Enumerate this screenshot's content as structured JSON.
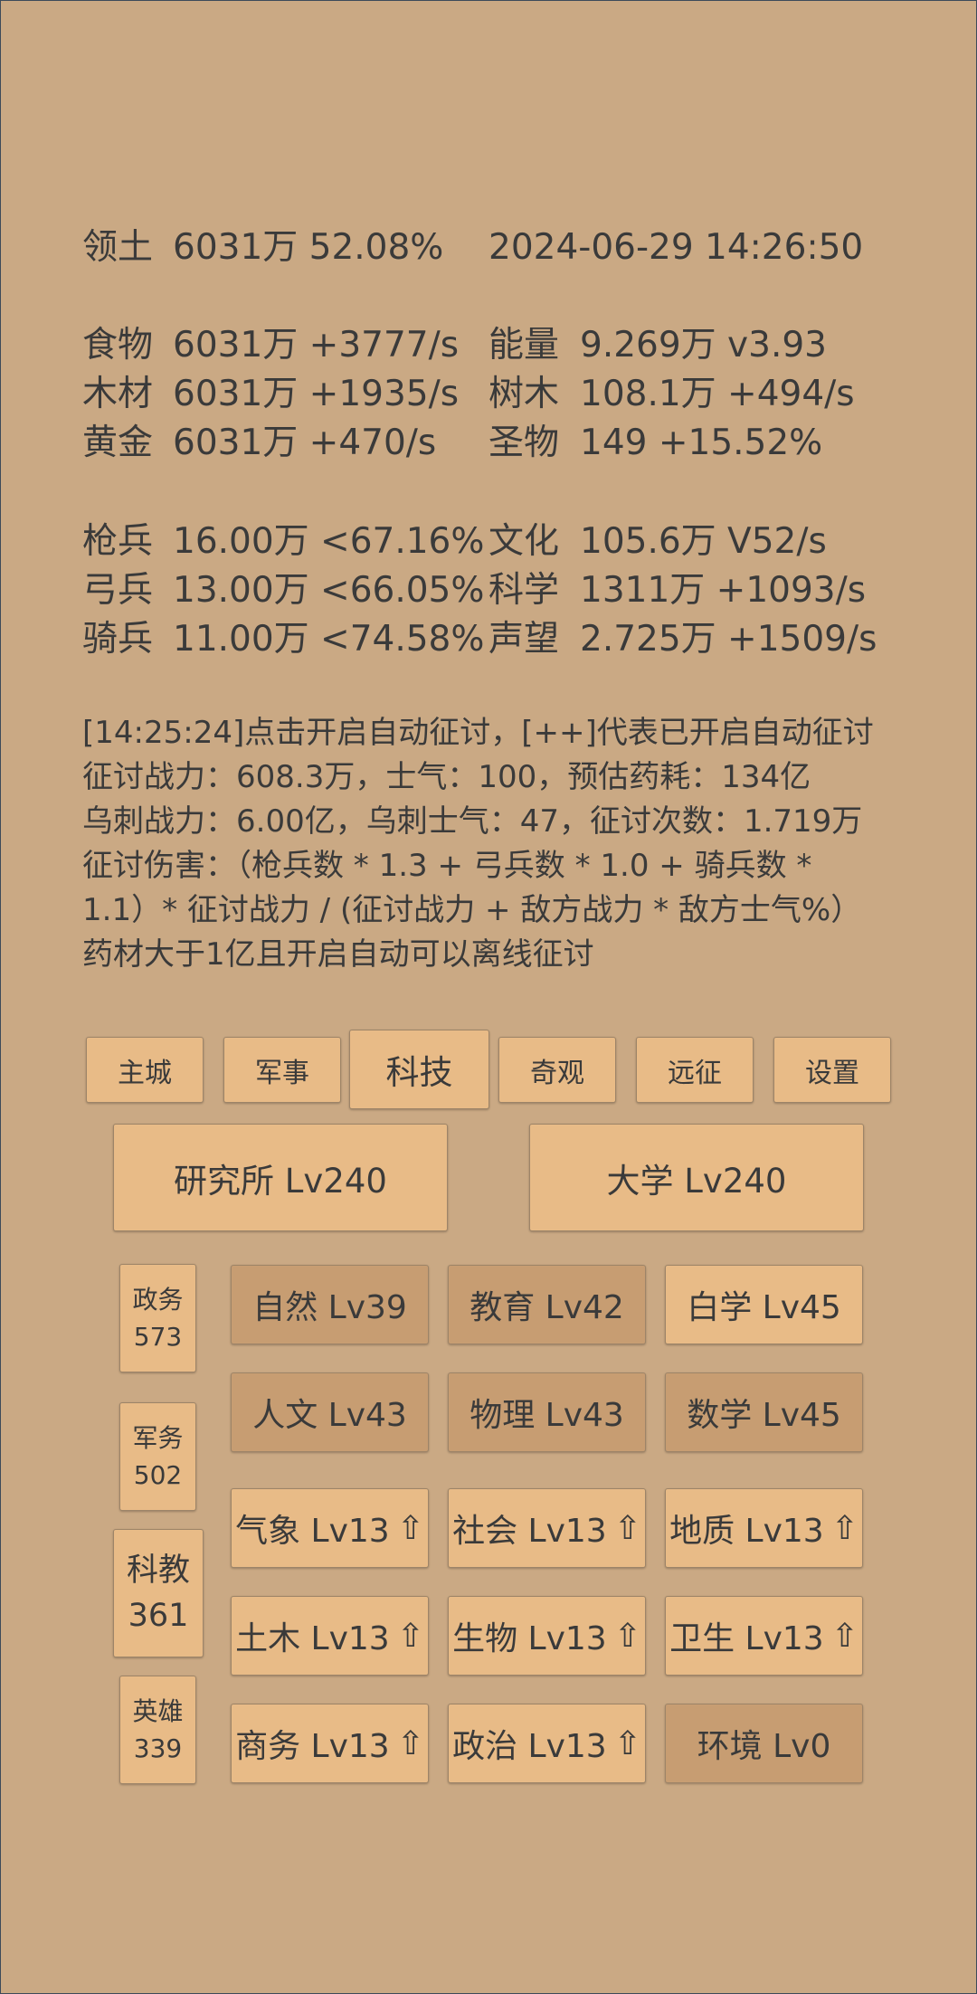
{
  "header": {
    "territory_label": "领土",
    "territory_value": "6031万  52.08%",
    "datetime": "2024-06-29 14:26:50"
  },
  "resources": [
    {
      "left_label": "食物",
      "left_value": "6031万 +3777/s",
      "right_label": "能量",
      "right_value": "9.269万  v3.93"
    },
    {
      "left_label": "木材",
      "left_value": "6031万 +1935/s",
      "right_label": "树木",
      "right_value": "108.1万 +494/s"
    },
    {
      "left_label": "黄金",
      "left_value": "6031万 +470/s",
      "right_label": "圣物",
      "right_value": "149 +15.52%"
    }
  ],
  "army": [
    {
      "left_label": "枪兵",
      "left_value": "16.00万 <67.16%",
      "right_label": "文化",
      "right_value": "105.6万 V52/s"
    },
    {
      "left_label": "弓兵",
      "left_value": "13.00万 <66.05%",
      "right_label": "科学",
      "right_value": "1311万 +1093/s"
    },
    {
      "left_label": "骑兵",
      "left_value": "11.00万 <74.58%",
      "right_label": "声望",
      "right_value": "2.725万 +1509/s"
    }
  ],
  "log": [
    "[14:25:24]点击开启自动征讨，[++]代表已开启自动征讨",
    "征讨战力：608.3万，士气：100，预估药耗：134亿",
    "乌刺战力：6.00亿，乌刺士气：47，征讨次数：1.719万",
    "征讨伤害：（枪兵数 * 1.3 + 弓兵数 * 1.0 + 骑兵数 *",
    "1.1）* 征讨战力 / (征讨战力 + 敌方战力 * 敌方士气%）",
    "药材大于1亿且开启自动可以离线征讨"
  ],
  "tabs": [
    "主城",
    "军事",
    "科技",
    "奇观",
    "远征",
    "设置"
  ],
  "active_tab": "科技",
  "buildings": [
    "研究所 Lv240",
    "大学 Lv240"
  ],
  "side_panel": [
    {
      "name": "政务",
      "value": "573"
    },
    {
      "name": "军务",
      "value": "502"
    },
    {
      "name": "科教",
      "value": "361"
    },
    {
      "name": "英雄",
      "value": "339"
    }
  ],
  "techs": [
    {
      "label": "自然 Lv39",
      "arrow": ""
    },
    {
      "label": "教育 Lv42",
      "arrow": ""
    },
    {
      "label": "白学 Lv45",
      "arrow": ""
    },
    {
      "label": "人文 Lv43",
      "arrow": ""
    },
    {
      "label": "物理 Lv43",
      "arrow": ""
    },
    {
      "label": "数学 Lv45",
      "arrow": ""
    },
    {
      "label": "气象 Lv13",
      "arrow": "⇧"
    },
    {
      "label": "社会 Lv13",
      "arrow": "⇧"
    },
    {
      "label": "地质 Lv13",
      "arrow": "⇧"
    },
    {
      "label": "土木 Lv13",
      "arrow": "⇧"
    },
    {
      "label": "生物 Lv13",
      "arrow": "⇧"
    },
    {
      "label": "卫生 Lv13",
      "arrow": "⇧"
    },
    {
      "label": "商务 Lv13",
      "arrow": "⇧"
    },
    {
      "label": "政治 Lv13",
      "arrow": "⇧"
    },
    {
      "label": "环境 Lv0",
      "arrow": ""
    }
  ],
  "colors": {
    "background": "#caa984",
    "button": "#e8bb87",
    "button_dark": "#c79d72",
    "text": "#3a3a3a"
  }
}
